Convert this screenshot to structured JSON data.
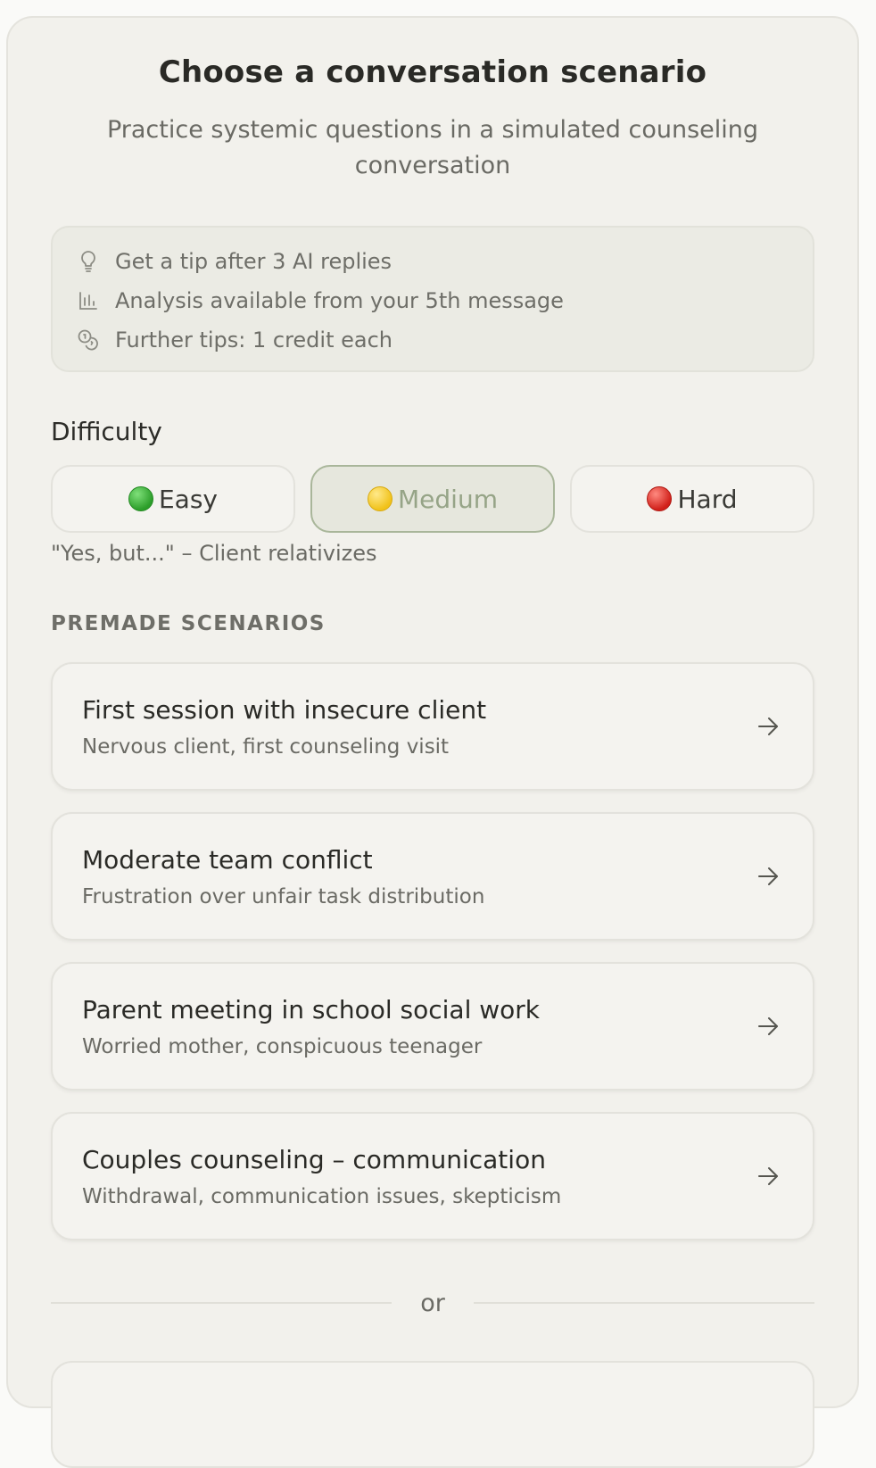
{
  "header": {
    "title": "Choose a conversation scenario",
    "subtitle": "Practice systemic questions in a simulated counseling conversation"
  },
  "info": {
    "items": [
      {
        "icon": "lightbulb-icon",
        "text": "Get a tip after 3 AI replies"
      },
      {
        "icon": "bar-chart-icon",
        "text": "Analysis available from your 5th message"
      },
      {
        "icon": "coins-icon",
        "text": "Further tips: 1 credit each"
      }
    ]
  },
  "difficulty": {
    "label": "Difficulty",
    "options": [
      {
        "label": "Easy",
        "dot": "green",
        "color": "#2c9e2a"
      },
      {
        "label": "Medium",
        "dot": "yellow",
        "color": "#f1c21a"
      },
      {
        "label": "Hard",
        "dot": "red",
        "color": "#d1201a"
      }
    ],
    "selected": "Medium",
    "description": "\"Yes, but...\" – Client relativizes"
  },
  "premade": {
    "label": "PREMADE SCENARIOS",
    "scenarios": [
      {
        "title": "First session with insecure client",
        "subtitle": "Nervous client, first counseling visit"
      },
      {
        "title": "Moderate team conflict",
        "subtitle": "Frustration over unfair task distribution"
      },
      {
        "title": "Parent meeting in school social work",
        "subtitle": "Worried mother, conspicuous teenager"
      },
      {
        "title": "Couples counseling – communication",
        "subtitle": "Withdrawal, communication issues, skepticism"
      }
    ]
  },
  "divider": {
    "label": "or"
  },
  "colors": {
    "accent": "#a9b69a",
    "background": "#f2f1ec"
  }
}
